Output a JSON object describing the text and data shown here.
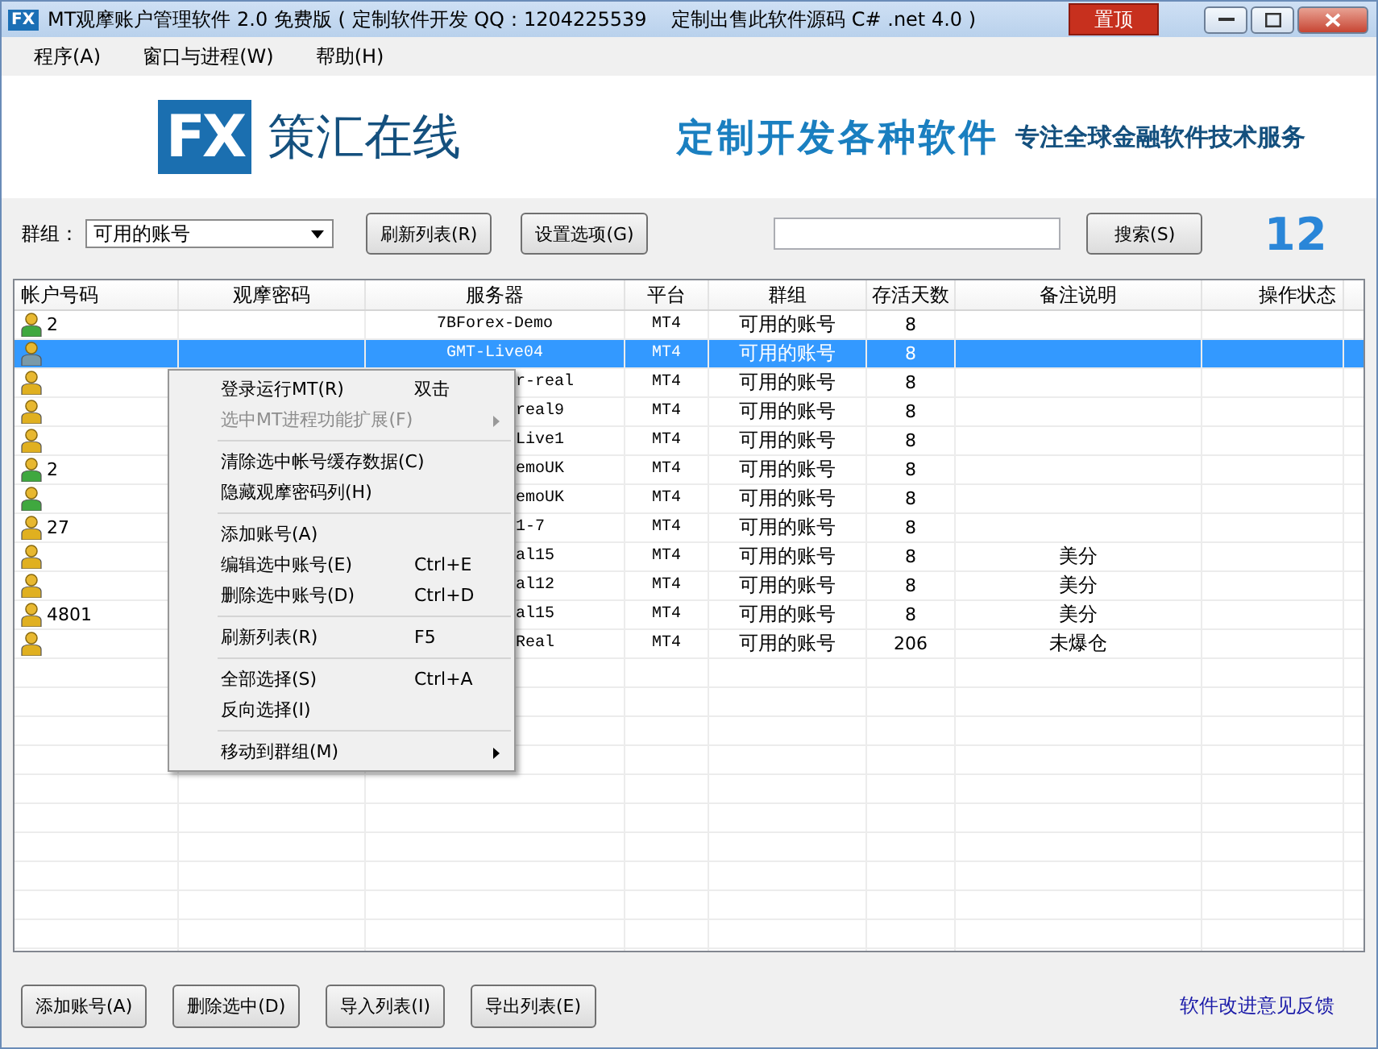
{
  "window": {
    "app_icon": "FX",
    "title": "MT观摩账户管理软件 2.0 免费版 ( 定制软件开发 QQ：1204225539    定制出售此软件源码 C# .net 4.0 )",
    "pin_button": "置顶"
  },
  "menu_bar": [
    "程序(A)",
    "窗口与进程(W)",
    "帮助(H)"
  ],
  "banner": {
    "logo_mark": "FX",
    "brand": "策汇在线",
    "slogan": "定制开发各种软件",
    "tagline": "专注全球金融软件技术服务"
  },
  "toolbar": {
    "group_label": "群组：",
    "group_value": "可用的账号",
    "buttons": [
      "刷新列表(R)",
      "设置选项(G)"
    ],
    "search_button": "搜索(S)",
    "count": "12"
  },
  "table": {
    "columns": [
      "帐户号码",
      "观摩密码",
      "服务器",
      "平台",
      "群组",
      "存活天数",
      "备注说明",
      "操作状态"
    ],
    "rows": [
      {
        "color": "#3fa83f",
        "selected": false,
        "account": "2",
        "server": "7BForex-Demo",
        "partial": false,
        "platform": "MT4",
        "group": "可用的账号",
        "days": "8"
      },
      {
        "color": "#7a9aa8",
        "selected": true,
        "server": "GMT-Live04",
        "partial": false,
        "platform": "MT4",
        "group": "可用的账号",
        "days": "8"
      },
      {
        "color": "#e0b020",
        "selected": false,
        "server": "r-real",
        "partial": true,
        "platform": "MT4",
        "group": "可用的账号",
        "days": "8"
      },
      {
        "color": "#e0b020",
        "selected": false,
        "server": "real9",
        "partial": true,
        "platform": "MT4",
        "group": "可用的账号",
        "days": "8"
      },
      {
        "color": "#e0b020",
        "selected": false,
        "server": "Live1",
        "partial": true,
        "platform": "MT4",
        "group": "可用的账号",
        "days": "8"
      },
      {
        "color": "#3fa83f",
        "selected": false,
        "account": "2",
        "server": "emoUK",
        "partial": true,
        "platform": "MT4",
        "group": "可用的账号",
        "days": "8"
      },
      {
        "color": "#3fa83f",
        "selected": false,
        "server": "emoUK",
        "partial": true,
        "platform": "MT4",
        "group": "可用的账号",
        "days": "8"
      },
      {
        "color": "#e0b020",
        "selected": false,
        "account": "27",
        "server": "1-7",
        "partial": true,
        "platform": "MT4",
        "group": "可用的账号",
        "days": "8"
      },
      {
        "color": "#e0b020",
        "selected": false,
        "server": "al15",
        "partial": true,
        "platform": "MT4",
        "group": "可用的账号",
        "days": "8",
        "note": "美分"
      },
      {
        "color": "#e0b020",
        "selected": false,
        "server": "al12",
        "partial": true,
        "platform": "MT4",
        "group": "可用的账号",
        "days": "8",
        "note": "美分"
      },
      {
        "color": "#e0b020",
        "selected": false,
        "account": "4801",
        "server": "al15",
        "partial": true,
        "platform": "MT4",
        "group": "可用的账号",
        "days": "8",
        "note": "美分"
      },
      {
        "color": "#e0b020",
        "selected": false,
        "server": "Real",
        "partial": true,
        "platform": "MT4",
        "group": "可用的账号",
        "days": "206",
        "note": "未爆仓"
      }
    ]
  },
  "context_menu": [
    [
      {
        "label": "登录运行MT(R)",
        "shortcut": "双击",
        "disabled": false,
        "submenu": false
      },
      {
        "label": "选中MT进程功能扩展(F)",
        "disabled": true,
        "submenu": true
      }
    ],
    [
      {
        "label": "清除选中帐号缓存数据(C)",
        "disabled": false,
        "submenu": false
      },
      {
        "label": "隐藏观摩密码列(H)",
        "disabled": false,
        "submenu": false
      }
    ],
    [
      {
        "label": "添加账号(A)",
        "disabled": false,
        "submenu": false
      },
      {
        "label": "编辑选中账号(E)",
        "shortcut": "Ctrl+E",
        "disabled": false,
        "submenu": false
      },
      {
        "label": "删除选中账号(D)",
        "shortcut": "Ctrl+D",
        "disabled": false,
        "submenu": false
      }
    ],
    [
      {
        "label": "刷新列表(R)",
        "shortcut": "F5",
        "disabled": false,
        "submenu": false
      }
    ],
    [
      {
        "label": "全部选择(S)",
        "shortcut": "Ctrl+A",
        "disabled": false,
        "submenu": false
      },
      {
        "label": "反向选择(I)",
        "disabled": false,
        "submenu": false
      }
    ],
    [
      {
        "label": "移动到群组(M)",
        "disabled": false,
        "submenu": true
      }
    ]
  ],
  "footer": {
    "buttons": [
      "添加账号(A)",
      "删除选中(D)",
      "导入列表(I)",
      "导出列表(E)"
    ],
    "feedback_link": "软件改进意见反馈"
  }
}
